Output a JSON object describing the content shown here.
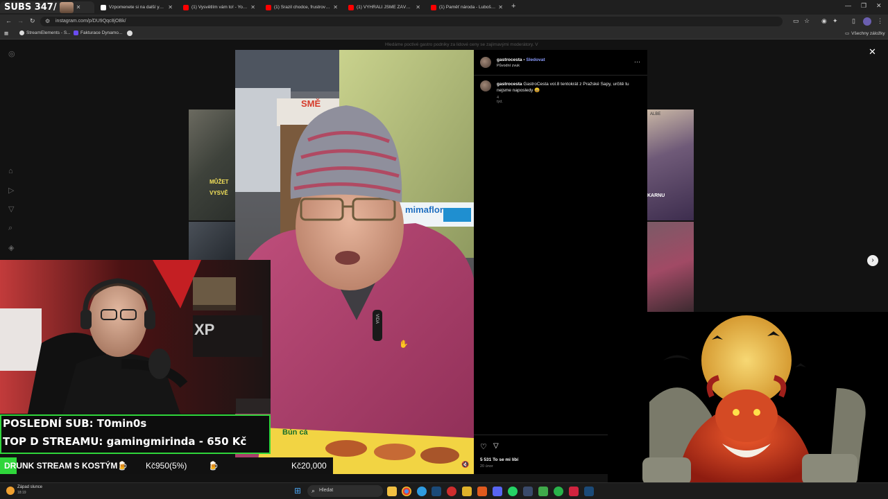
{
  "browser": {
    "tabs": [
      {
        "label": "SUBS 347/",
        "active": true
      },
      {
        "label": "Vzpomenete si na další youtuber"
      },
      {
        "label": "(1) Vysvětlím vám to! - YouTube"
      },
      {
        "label": "(1) Srazil chodce, frustrovaný ..."
      },
      {
        "label": "(1) VYHRÁLI JSME ZÁVODY NA ..."
      },
      {
        "label": "(1) Paměť národa - Luboš Bala..."
      }
    ],
    "url": "instagram.com/p/DU9Qqc8jOBk/",
    "bookmarks": [
      "StreamElements - S...",
      "Fakturace Dynamo..."
    ],
    "all_bookmarks": "Všechny záložky"
  },
  "banner_text": "Hledáme poctivé gastro podniky za lidové ceny se zajímavými moderátory. V",
  "post": {
    "username": "gastrocesta",
    "follow": "Sledovat",
    "audio": "Původní zvuk",
    "caption_user": "gastrocesta",
    "caption": "GastroCesta vol.8 tentokrát z Pražské Sapy, určitě tu nejsme naposledy 😄",
    "time": "4 týd.",
    "likes": "5 531 To se mi líbí",
    "date": "20 únor"
  },
  "video": {
    "sign_left": "SMĚ",
    "sign_right": "mimaflor",
    "mic_label": "VIDA",
    "menu_text": "Bún cá"
  },
  "webcam": {
    "shelf_text": "XP"
  },
  "side_thumbs": {
    "left_text_1": "MŮŽET",
    "left_text_2": "VYSVĚ",
    "right_text": "ALBE",
    "right_sign": "KARNU"
  },
  "overlay": {
    "last_sub": "POSLEDNÍ SUB: T0min0s",
    "top_donor": "TOP D STREAMU: gamingmirinda - 650 Kč",
    "ticker": "DRUNK STREAM S KOSTÝM🍺",
    "current": "Kč950(5%)",
    "goal": "Kč20,000",
    "emoji": "🍺"
  },
  "taskbar": {
    "weather": "Západ slunce",
    "time": "18:19",
    "search": "Hledat"
  },
  "colors": {
    "follow": "#8c9dff",
    "sub_border": "#2fd63b",
    "instagram_bg": "#121212"
  }
}
